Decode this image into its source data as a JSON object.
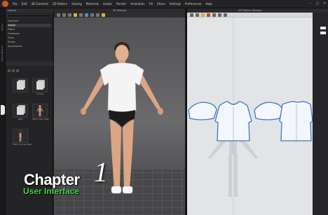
{
  "menubar": {
    "items": [
      "File",
      "Edit",
      "3D Garment",
      "2D Pattern",
      "Sewing",
      "Materials",
      "Avatar",
      "Render",
      "Animation",
      "Fill",
      "Share",
      "Settings",
      "Preferences",
      "Help"
    ],
    "right_items": [
      "Edit Mode"
    ]
  },
  "left_strip": {
    "tabs": [
      "Library",
      "Object Browser"
    ]
  },
  "library": {
    "title": "Library",
    "rows": [
      "Garment",
      "Avatar",
      "Fabric",
      "Hardware",
      "Trims",
      "Shoes",
      "Accessories"
    ],
    "selected_index": 1,
    "thumbs": [
      {
        "caption": "..."
      },
      {
        "caption": "Female"
      },
      {
        "caption": "Male"
      },
      {
        "caption": "FW21_Male_Walk"
      },
      {
        "caption": "FW21_Female_Walk"
      }
    ]
  },
  "window3d": {
    "title": "3D Window"
  },
  "window2d": {
    "title": "2D Pattern Window"
  },
  "overlay": {
    "chapter_label": "Chapter",
    "chapter_number": "1",
    "subtitle": "User Interface"
  },
  "colors": {
    "accent_green": "#3fd14a",
    "logo_orange": "#d0572a",
    "pattern_blue": "#3f78c4"
  }
}
